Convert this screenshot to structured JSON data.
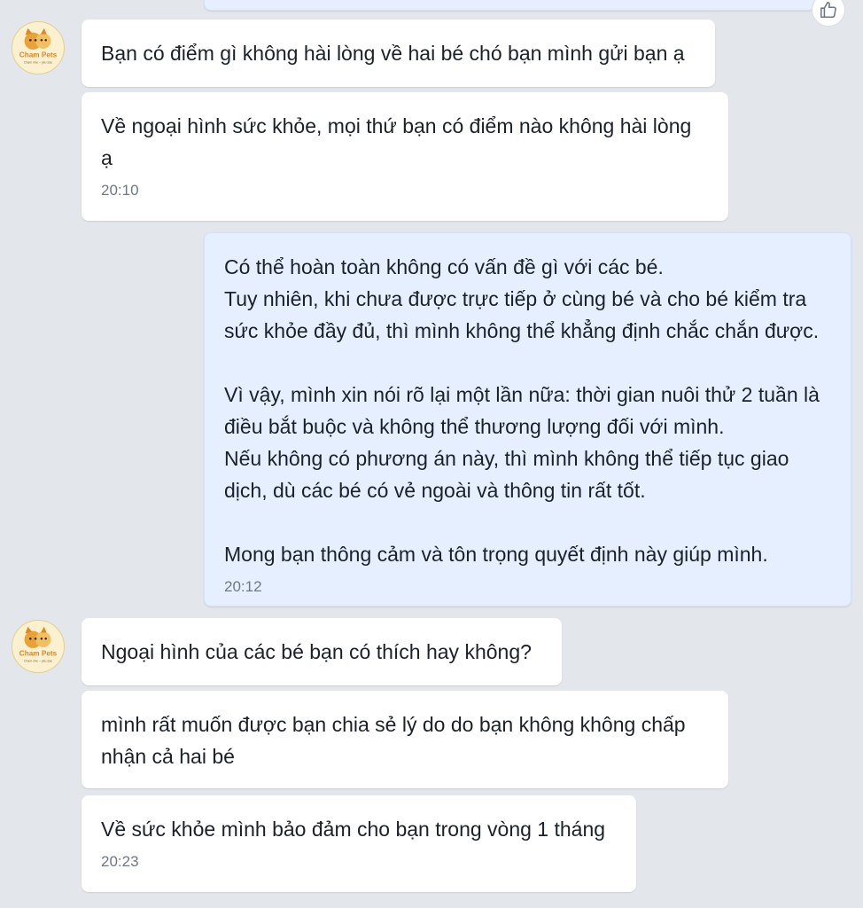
{
  "avatar": {
    "brand_text": "Cham Pets",
    "tagline": "Chạm nhẹ – yêu sâu"
  },
  "messages": [
    {
      "text": "Bạn có điểm gì không hài lòng về hai bé chó bạn mình gửi bạn ạ"
    },
    {
      "text": "Về ngoại hình sức khỏe, mọi thứ bạn có điểm nào không hài lòng\nạ",
      "time": "20:10"
    },
    {
      "text": "Có thể hoàn toàn không có vấn đề gì với các bé.\nTuy nhiên, khi chưa được trực tiếp ở cùng bé và cho bé kiểm tra\nsức khỏe đầy đủ, thì mình không thể khẳng định chắc chắn được.\n\nVì vậy, mình xin nói rõ lại một lần nữa: thời gian nuôi thử 2 tuần là\nđiều bắt buộc và không thể thương lượng đối với mình.\nNếu không có phương án này, thì mình không thể tiếp tục giao\ndịch, dù các bé có vẻ ngoài và thông tin rất tốt.\n\nMong bạn thông cảm và tôn trọng quyết định này giúp mình.",
      "time": "20:12"
    },
    {
      "text": "Ngoại hình của các bé bạn có thích hay không?"
    },
    {
      "text": "mình rất muốn được bạn chia sẻ lý do do bạn không không chấp\nnhận cả hai bé"
    },
    {
      "text": "Về sức khỏe mình bảo đảm cho bạn trong vòng 1 tháng",
      "time": "20:23"
    }
  ]
}
